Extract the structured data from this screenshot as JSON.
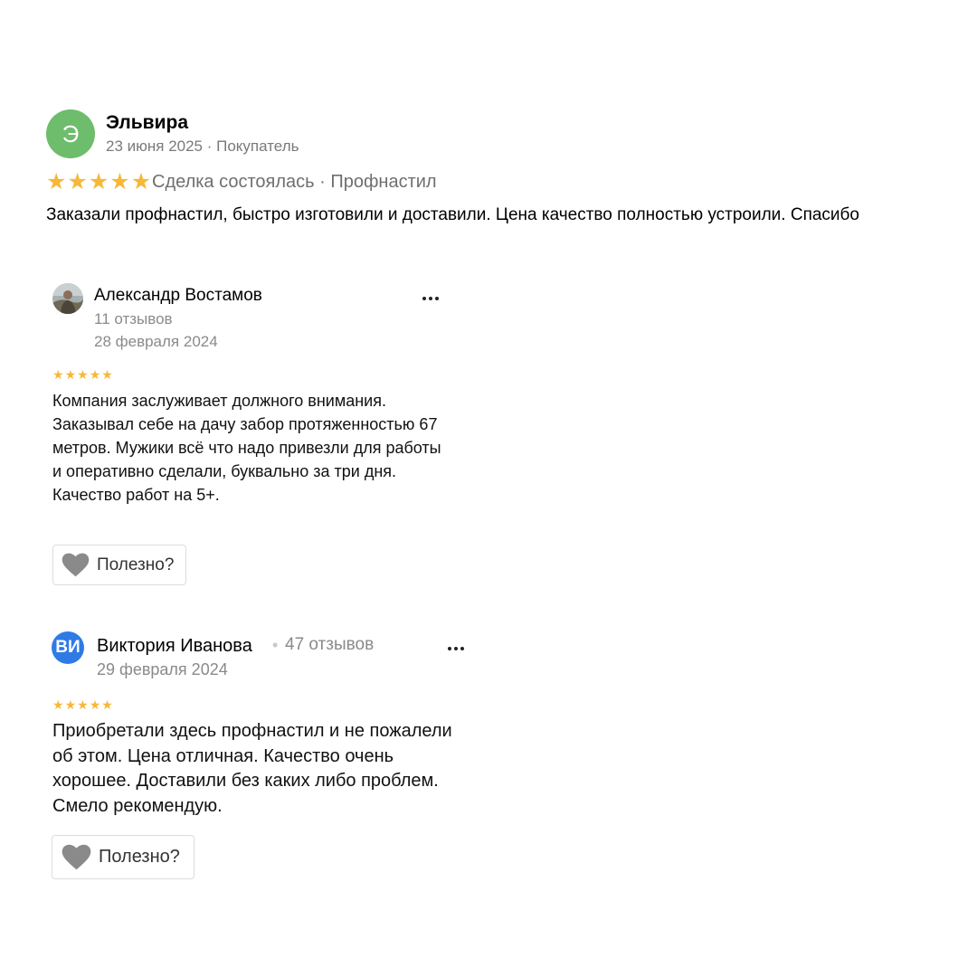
{
  "review1": {
    "avatar_letter": "Э",
    "avatar_color": "#6dbd6c",
    "author": "Эльвира",
    "meta": "23 июня 2025 · Покупатель",
    "rating": 5,
    "tags": "Сделка состоялась · Профнастил",
    "text": "Заказали профнастил, быстро изготовили и доставили. Цена качество полностью устроили. Спасибо"
  },
  "review2": {
    "author": "Александр Востамов",
    "reviews_count": "11 отзывов",
    "date": "28 февраля 2024",
    "rating": 5,
    "text": "Компания заслуживает должного внимания. Заказывал себе на дачу забор протяженностью 67 метров. Мужики всё что надо привезли для работы и оперативно сделали, буквально за три дня. Качество работ на 5+.",
    "useful_label": "Полезно?"
  },
  "review3": {
    "avatar_initials": "ВИ",
    "avatar_color": "#2f7be5",
    "author": "Виктория Иванова",
    "separator": "•",
    "reviews_count": "47 отзывов",
    "date": "29 февраля 2024",
    "rating": 5,
    "text": "Приобретали здесь профнастил и не пожалели об этом. Цена отличная. Качество очень хорошее. Доставили без каких либо проблем. Смело рекомендую.",
    "useful_label": "Полезно?"
  },
  "colors": {
    "star": "#f6b83a",
    "heart": "#8a8a8a"
  }
}
